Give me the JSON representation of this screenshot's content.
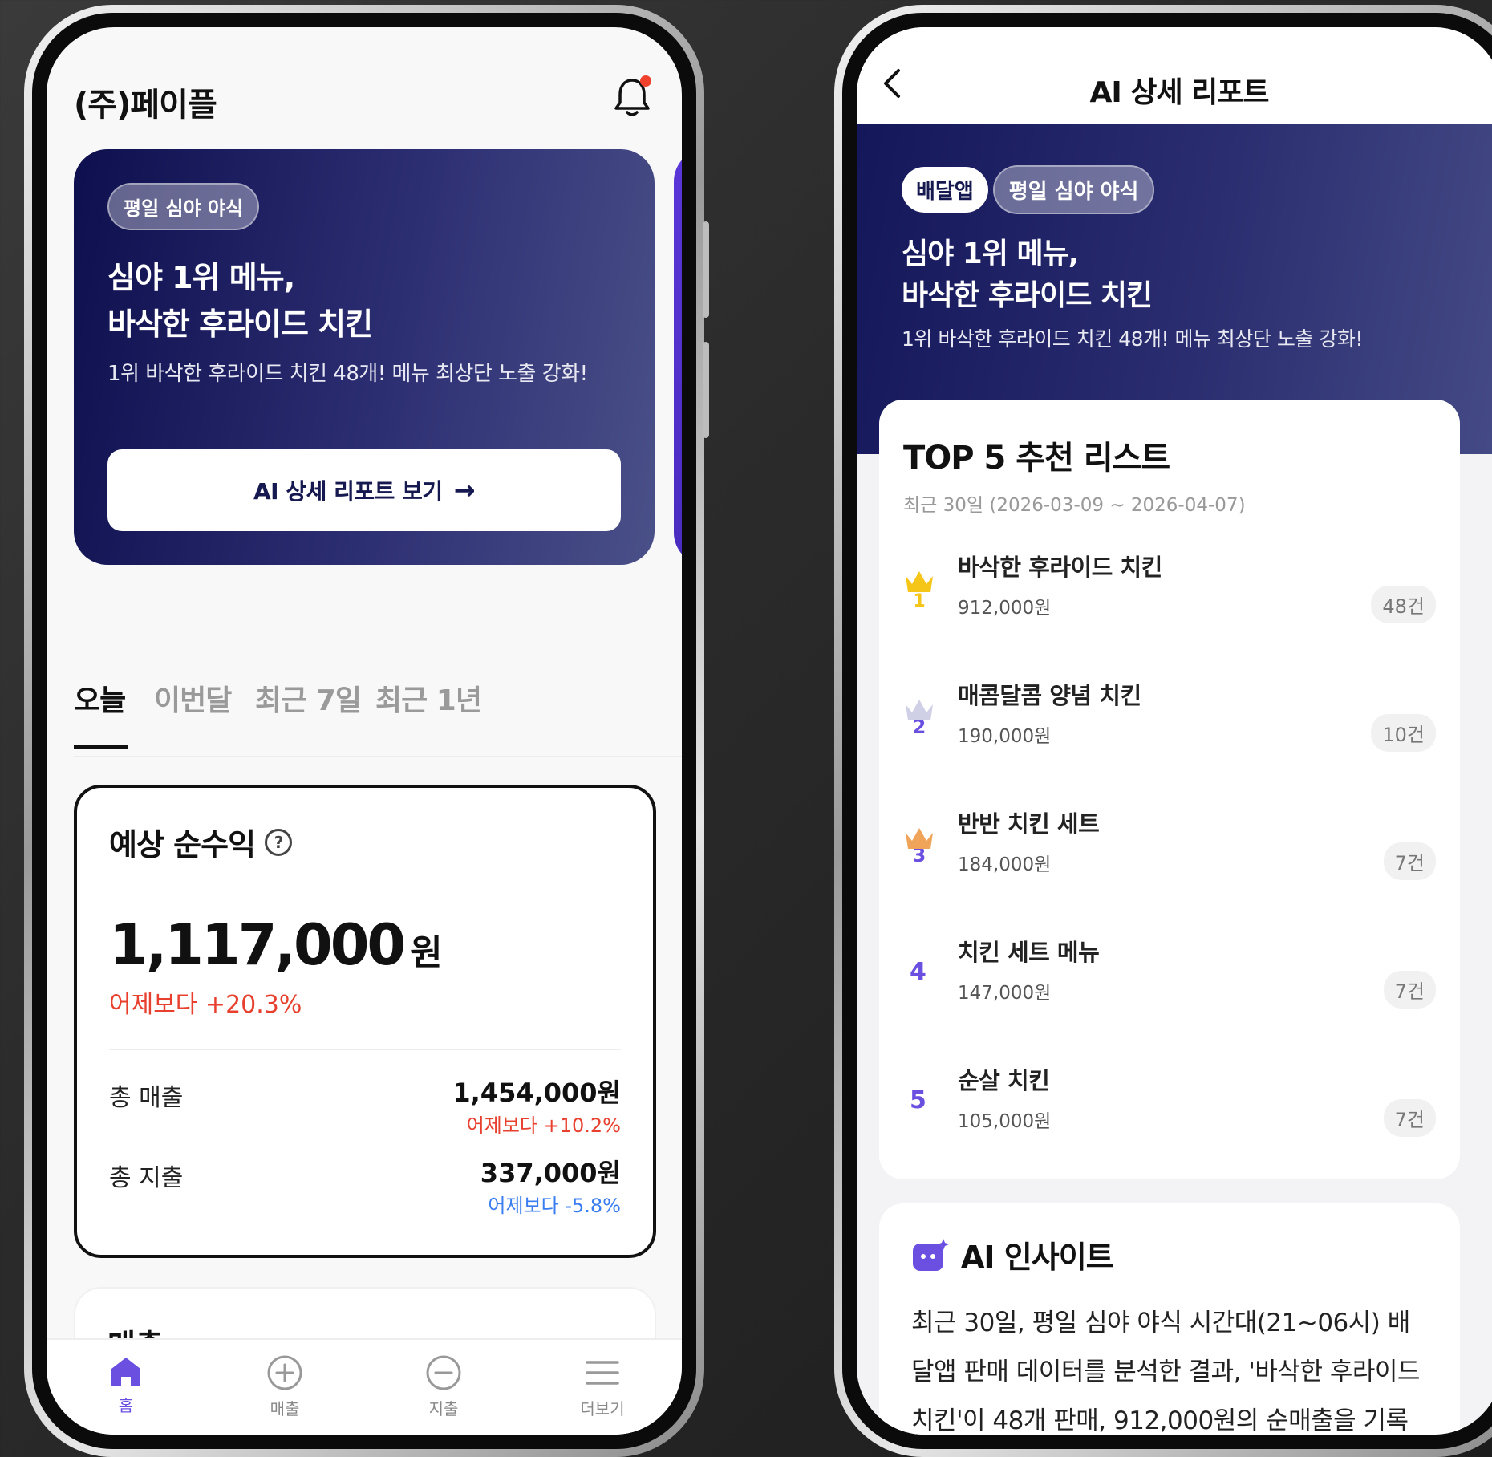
{
  "left_phone": {
    "company": "(주)페이플",
    "promo": {
      "chip": "평일 심야 야식",
      "title_line1": "심야 1위 메뉴,",
      "title_line2": "바삭한 후라이드 치킨",
      "subtitle": "1위 바삭한 후라이드 치킨 48개! 메뉴 최상단 노출 강화!",
      "button_label": "AI 상세 리포트 보기",
      "button_arrow": "→"
    },
    "tabs": [
      "오늘",
      "이번달",
      "최근 7일",
      "최근 1년"
    ],
    "active_tab": "오늘",
    "profit": {
      "title": "예상 순수익",
      "help": "?",
      "amount": "1,117,000",
      "unit": "원",
      "delta": "어제보다 +20.3%",
      "rows": [
        {
          "label": "총 매출",
          "value": "1,454,000원",
          "delta": "어제보다 +10.2%"
        },
        {
          "label": "총 지출",
          "value": "337,000원",
          "delta": "어제보다 -5.8%"
        }
      ]
    },
    "sales_title": "매출",
    "nav": [
      {
        "label": "홈",
        "icon": "home-icon"
      },
      {
        "label": "매출",
        "icon": "plus-circle-icon"
      },
      {
        "label": "지출",
        "icon": "minus-circle-icon"
      },
      {
        "label": "더보기",
        "icon": "menu-icon"
      }
    ]
  },
  "right_phone": {
    "title": "AI 상세 리포트",
    "banner": {
      "chip1": "배달앱",
      "chip2": "평일 심야 야식",
      "title_line1": "심야 1위 메뉴,",
      "title_line2": "바삭한 후라이드 치킨",
      "subtitle": "1위 바삭한 후라이드 치킨 48개! 메뉴 최상단 노출 강화!"
    },
    "top5": {
      "title": "TOP 5 추천 리스트",
      "period": "최근 30일 (2026-03-09 ~ 2026-04-07)",
      "items": [
        {
          "rank": "1",
          "name": "바삭한 후라이드 치킨",
          "amount": "912,000원",
          "count": "48건",
          "icon": "gold-crown-icon"
        },
        {
          "rank": "2",
          "name": "매콤달콤 양념 치킨",
          "amount": "190,000원",
          "count": "10건",
          "icon": "silver-crown-icon"
        },
        {
          "rank": "3",
          "name": "반반 치킨 세트",
          "amount": "184,000원",
          "count": "7건",
          "icon": "bronze-crown-icon"
        },
        {
          "rank": "4",
          "name": "치킨 세트 메뉴",
          "amount": "147,000원",
          "count": "7건"
        },
        {
          "rank": "5",
          "name": "순살 치킨",
          "amount": "105,000원",
          "count": "7건"
        }
      ]
    },
    "insight": {
      "title": "AI 인사이트",
      "body": "최근 30일, 평일 심야 야식 시간대(21~06시) 배달앱 판매 데이터를 분석한 결과, '바삭한 후라이드 치킨'이 48개 판매, 912,000원의 순매출을 기록"
    }
  },
  "colors": {
    "accent": "#6a4fe0",
    "navy": "#14175a",
    "up_red": "#e8402f",
    "down_blue": "#3a7df0"
  }
}
